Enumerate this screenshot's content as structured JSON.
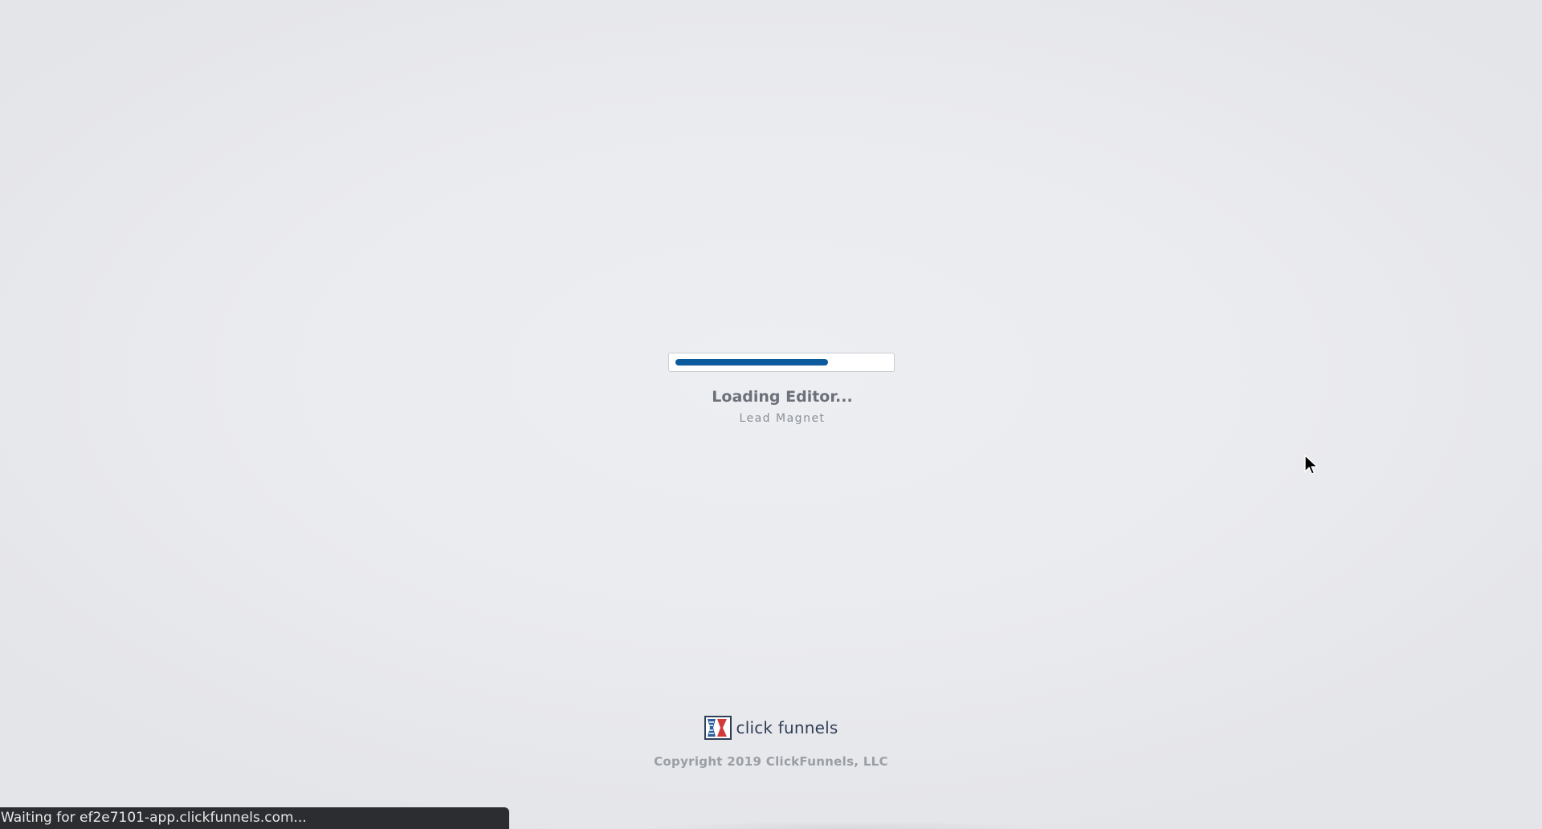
{
  "loader": {
    "progress_percent": 72,
    "title": "Loading Editor...",
    "subtitle": "Lead Magnet"
  },
  "brand": {
    "logo_icon": "clickfunnels-logo-icon",
    "name": "click funnels",
    "copyright": "Copyright 2019 ClickFunnels, LLC"
  },
  "status_bar": {
    "text": "Waiting for ef2e7101-app.clickfunnels.com..."
  },
  "colors": {
    "progress_fill": "#0c5b9c",
    "logo_blue": "#2b5c9e",
    "logo_red": "#d33b3b"
  }
}
